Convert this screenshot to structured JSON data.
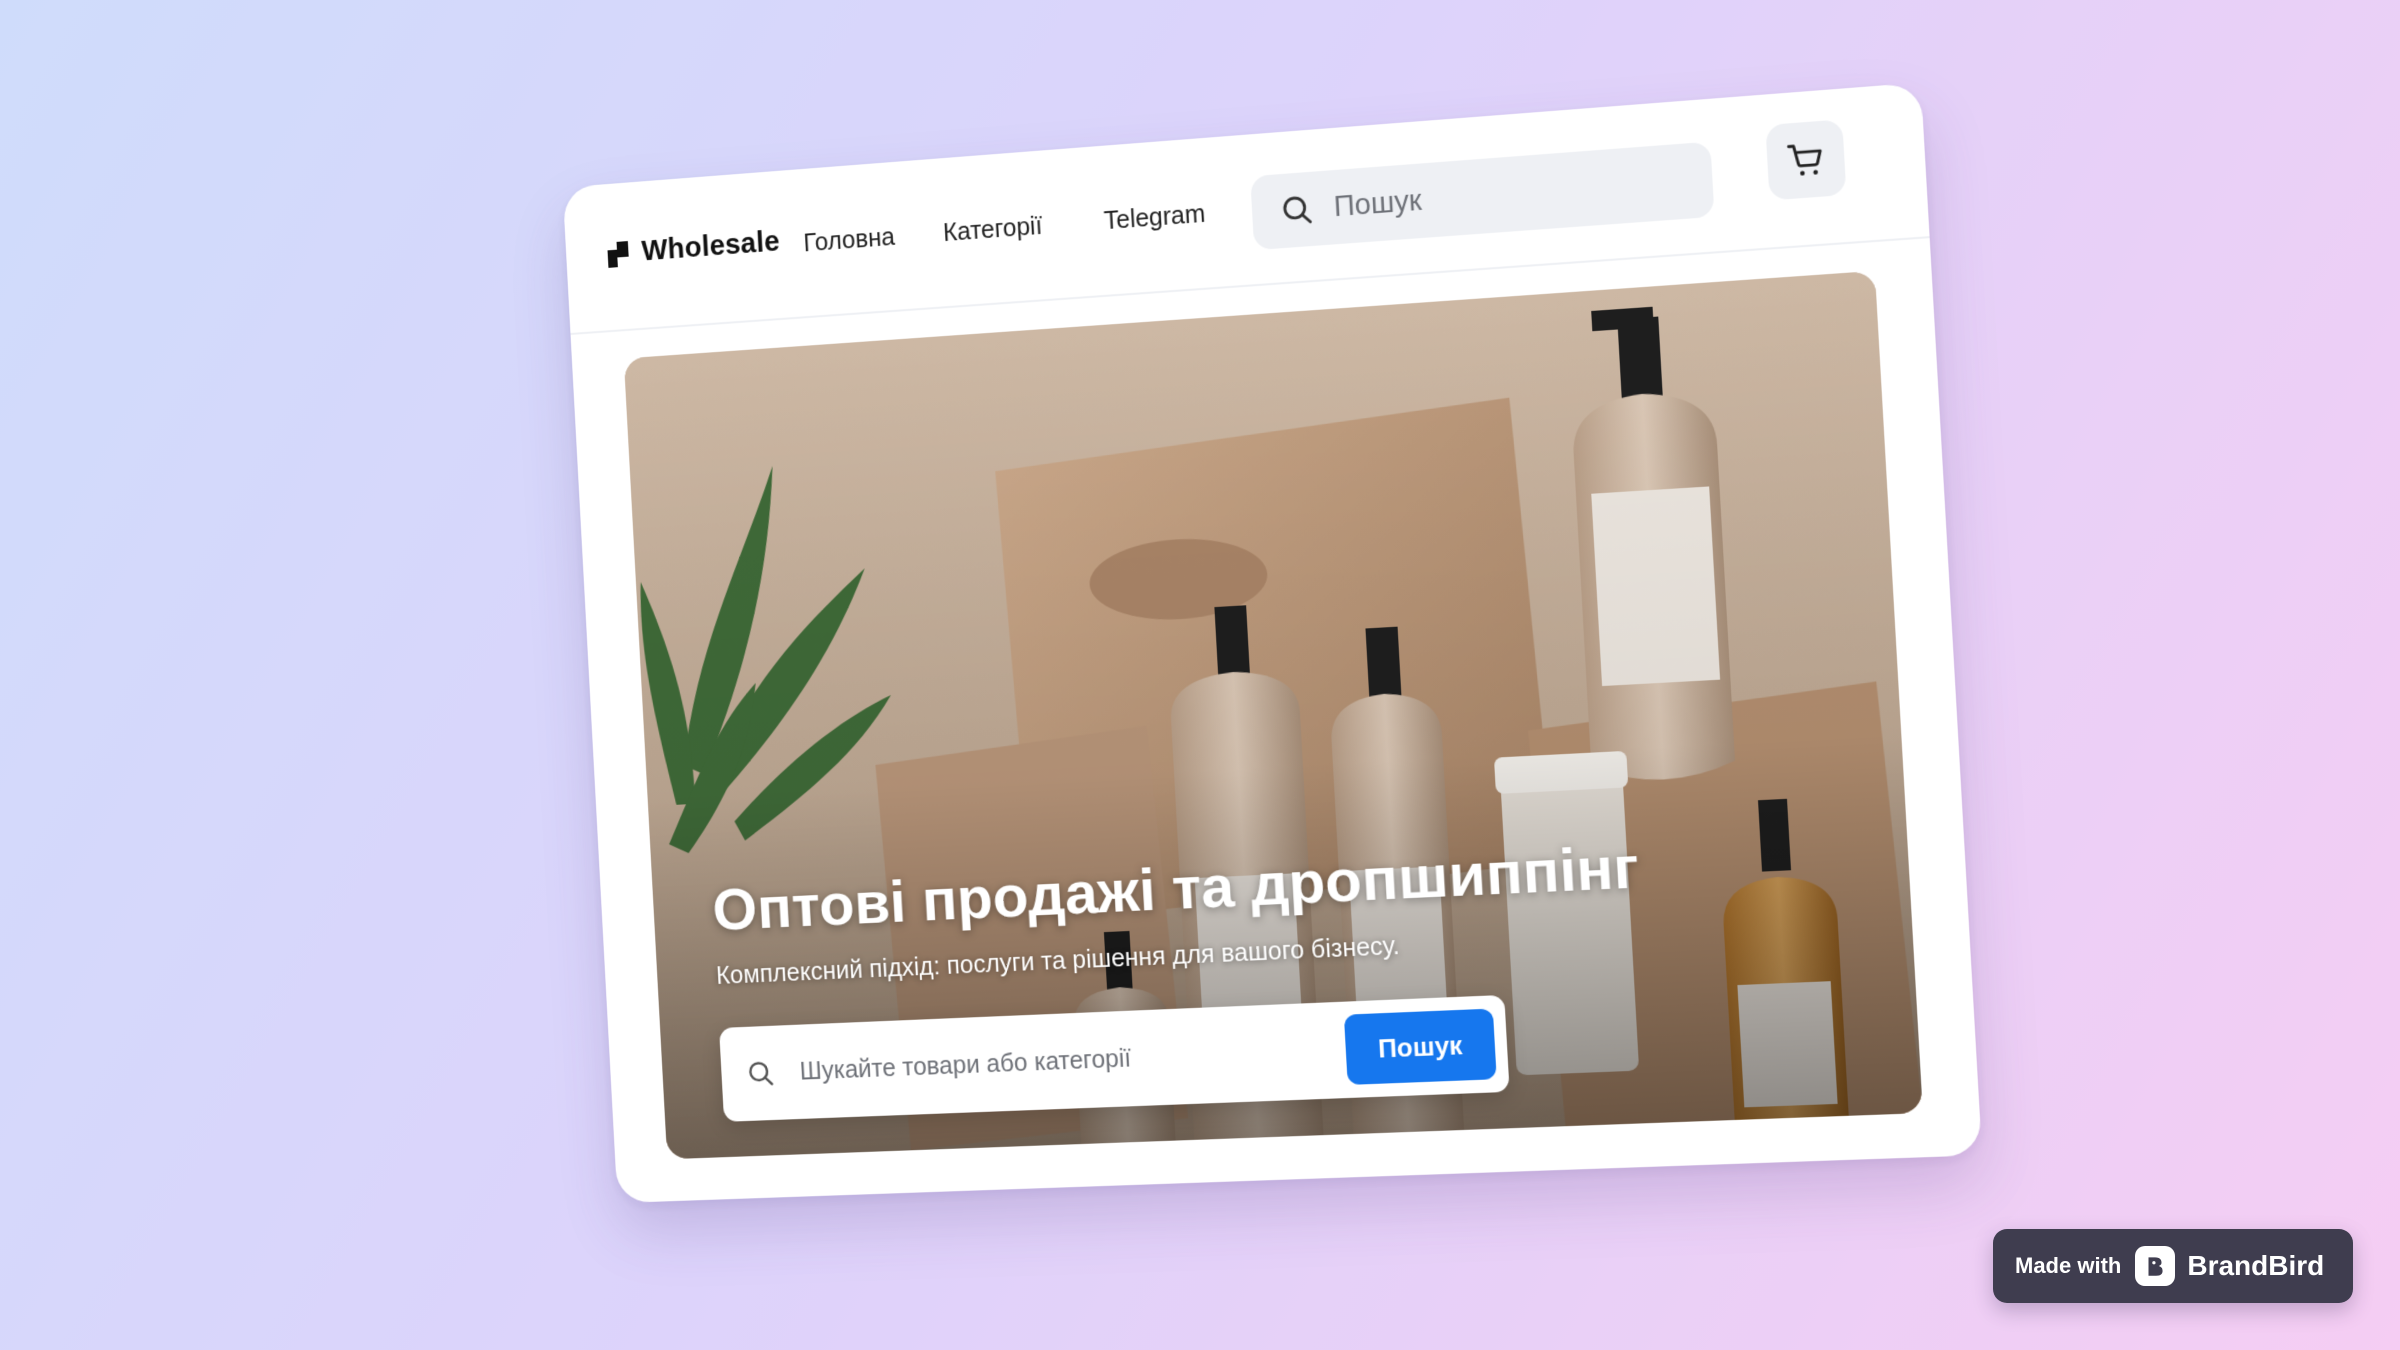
{
  "navbar": {
    "logo_text": "Wholesale",
    "links": [
      "Головна",
      "Категорії",
      "Telegram"
    ],
    "search_placeholder": "Пошук",
    "cart_icon": "cart-icon"
  },
  "hero": {
    "title": "Оптові продажі та дропшиппінг",
    "subtitle": "Комплексний підхід: послуги та рішення для вашого бізнесу.",
    "search_placeholder": "Шукайте товари або категорії",
    "search_button": "Пошук",
    "image": "cosmetic-bottles-and-boxes-photo"
  },
  "badge": {
    "made_with": "Made with",
    "brand": "BrandBird"
  },
  "colors": {
    "accent": "#1677ee",
    "background_start": "#cfdcfb",
    "background_end": "#f5cdf3",
    "badge_bg": "#3f3d4f"
  }
}
